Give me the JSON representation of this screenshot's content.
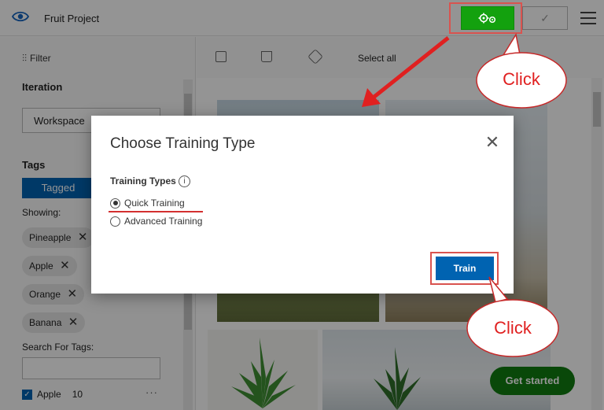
{
  "header": {
    "app_title": "Fruit Project",
    "icons": {
      "brand": "eye-icon",
      "train": "gears-icon",
      "publish": "check-icon",
      "menu": "hamburger-icon"
    }
  },
  "sidebar": {
    "filter_label": "Filter",
    "iteration_label": "Iteration",
    "iteration_value": "Workspace",
    "tags_label": "Tags",
    "tagged_button": "Tagged",
    "showing_label": "Showing:",
    "tag_chips": [
      "Pineapple",
      "Apple",
      "Orange",
      "Banana"
    ],
    "search_label": "Search For Tags:",
    "search_value": "",
    "tag_list": [
      {
        "name": "Apple",
        "count": "10",
        "checked": true
      }
    ],
    "more": "···"
  },
  "toolbar": {
    "select_all": "Select all",
    "icons": [
      "add-images-icon",
      "delete-icon",
      "tag-icon"
    ]
  },
  "get_started": "Get started",
  "dialog": {
    "title": "Choose Training Type",
    "close": "✕",
    "training_types_label": "Training Types",
    "info": "i",
    "options": [
      {
        "label": "Quick Training",
        "selected": true
      },
      {
        "label": "Advanced Training",
        "selected": false
      }
    ],
    "train_button": "Train"
  },
  "annotations": {
    "click_top": "Click",
    "click_bottom": "Click",
    "color_red": "#d32f2f",
    "color_green": "#13a10e",
    "color_blue": "#0063b1"
  }
}
